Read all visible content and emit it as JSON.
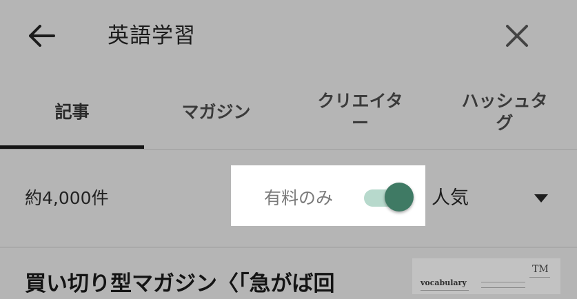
{
  "header": {
    "back_icon": "arrow-left-icon",
    "title": "英語学習",
    "close_icon": "close-icon"
  },
  "tabs": [
    {
      "label": "記事",
      "selected": true
    },
    {
      "label": "マガジン",
      "selected": false
    },
    {
      "label": "クリエイタ\nー",
      "selected": false
    },
    {
      "label": "ハッシュタ\nグ",
      "selected": false
    }
  ],
  "filter": {
    "count": "約4,000件",
    "paid_only_label": "有料のみ",
    "paid_only_on": true,
    "sort_value": "人気",
    "sort_icon": "caret-down-icon"
  },
  "article": {
    "title": "買い切り型マガジン〈「急がば回",
    "thumbnail_word": "vocabulary",
    "thumbnail_logo": "TM"
  },
  "colors": {
    "background": "#b5b5b5",
    "highlight": "#ffffff",
    "toggle_track": "#b7d9cc",
    "toggle_knob": "#3f7a64",
    "tab_indicator": "#151515"
  }
}
